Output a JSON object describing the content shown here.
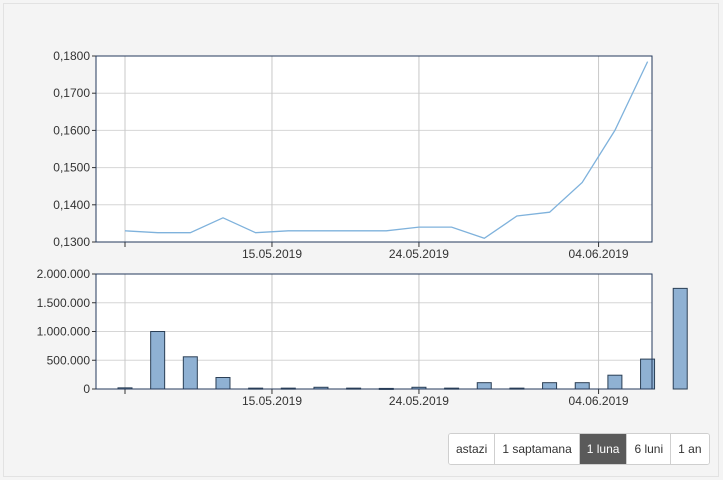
{
  "chart_data": [
    {
      "type": "line",
      "x": [
        "2019-05-06",
        "2019-05-08",
        "2019-05-10",
        "2019-05-12",
        "2019-05-14",
        "2019-05-16",
        "2019-05-18",
        "2019-05-20",
        "2019-05-22",
        "2019-05-24",
        "2019-05-26",
        "2019-05-28",
        "2019-05-30",
        "2019-06-01",
        "2019-06-03",
        "2019-06-05",
        "2019-06-07"
      ],
      "series": [
        {
          "values": [
            0.133,
            0.1325,
            0.1325,
            0.1365,
            0.1325,
            0.133,
            0.133,
            0.133,
            0.133,
            0.134,
            0.134,
            0.131,
            0.137,
            0.138,
            0.146,
            0.16,
            0.1785
          ]
        }
      ],
      "yticks": [
        "0,1300",
        "0,1400",
        "0,1500",
        "0,1600",
        "0,1700",
        "0,1800"
      ],
      "xticks": [
        "15.05.2019",
        "24.05.2019",
        "04.06.2019"
      ],
      "ylim": [
        0.13,
        0.18
      ],
      "grid": true,
      "color": "#7fb2dc"
    },
    {
      "type": "bar",
      "x": [
        "2019-05-06",
        "2019-05-08",
        "2019-05-10",
        "2019-05-12",
        "2019-05-14",
        "2019-05-16",
        "2019-05-18",
        "2019-05-20",
        "2019-05-22",
        "2019-05-24",
        "2019-05-26",
        "2019-05-28",
        "2019-05-30",
        "2019-06-01",
        "2019-06-03",
        "2019-06-05",
        "2019-06-07",
        "2019-06-09"
      ],
      "series": [
        {
          "values": [
            20000,
            1000000,
            560000,
            200000,
            15000,
            15000,
            30000,
            15000,
            10000,
            30000,
            15000,
            110000,
            15000,
            110000,
            110000,
            240000,
            520000,
            1750000
          ]
        }
      ],
      "yticks": [
        "0",
        "500.000",
        "1.000.000",
        "1.500.000",
        "2.000.000"
      ],
      "xticks": [
        "15.05.2019",
        "24.05.2019",
        "04.06.2019"
      ],
      "ylim": [
        0,
        2000000
      ],
      "grid": true,
      "color": "#8fb1d3"
    }
  ],
  "range_selector": {
    "buttons": [
      "astazi",
      "1 saptamana",
      "1 luna",
      "6 luni",
      "1 an"
    ],
    "active": "1 luna"
  }
}
